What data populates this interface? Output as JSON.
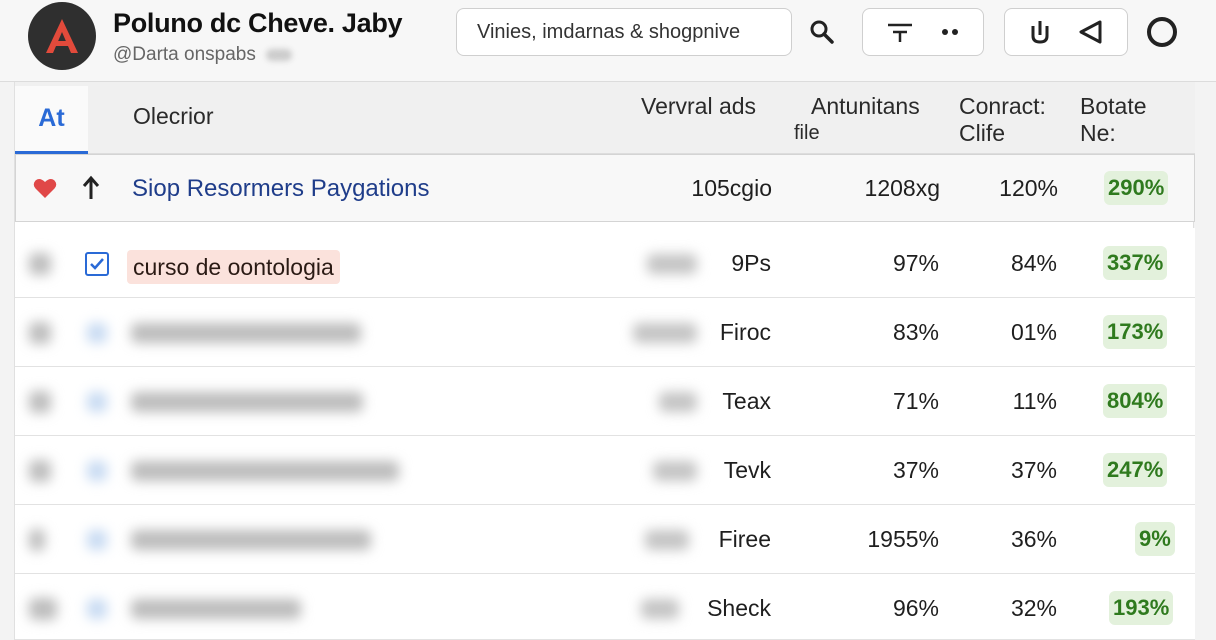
{
  "header": {
    "title": "Poluno dc Cheve. Jaby",
    "handle": "@Darta onspabs",
    "search_value": "Vinies, imdarnas & shogpnive"
  },
  "table": {
    "tab_label": "At",
    "columns": {
      "name": "Olecrior",
      "volume": "Vervral ads",
      "antunitans": "Antunitans",
      "antunitans_sub": "file",
      "conract_l1": "Conract:",
      "conract_l2": "Clife",
      "botate_l1": "Botate",
      "botate_l2": "Ne:"
    },
    "featured_row": {
      "name": "Siop Resormers Paygations",
      "volume": "105cgio",
      "antunitans": "1208xg",
      "conract": "120%",
      "botate": "290%"
    },
    "rows": [
      {
        "keyword": "curso de oontologia",
        "volume": "9Ps",
        "antunitans": "97%",
        "conract": "84%",
        "botate": "337%"
      },
      {
        "keyword": "",
        "volume": "Firoc",
        "antunitans": "83%",
        "conract": "01%",
        "botate": "173%"
      },
      {
        "keyword": "",
        "volume": "Teax",
        "antunitans": "71%",
        "conract": "11%",
        "botate": "804%"
      },
      {
        "keyword": "",
        "volume": "Tevk",
        "antunitans": "37%",
        "conract": "37%",
        "botate": "247%"
      },
      {
        "keyword": "",
        "volume": "Firee",
        "antunitans": "1955%",
        "conract": "36%",
        "botate": "9%"
      },
      {
        "keyword": "",
        "volume": "Sheck",
        "antunitans": "96%",
        "conract": "32%",
        "botate": "193%"
      }
    ]
  },
  "colors": {
    "accent": "#2a6ad6",
    "logo_bg": "#2f2f2f",
    "logo_mark": "#e24a3b",
    "positive_text": "#2f7a1e",
    "positive_bg": "#e3f1dc",
    "heart": "#e04848",
    "keyword_chip": "#fbe2dc"
  },
  "icons": [
    "logo-icon",
    "search-icon",
    "filter-icon",
    "more-icon",
    "download-icon",
    "back-icon",
    "circle-icon",
    "heart-icon",
    "arrow-up-icon",
    "checkbox-icon"
  ]
}
